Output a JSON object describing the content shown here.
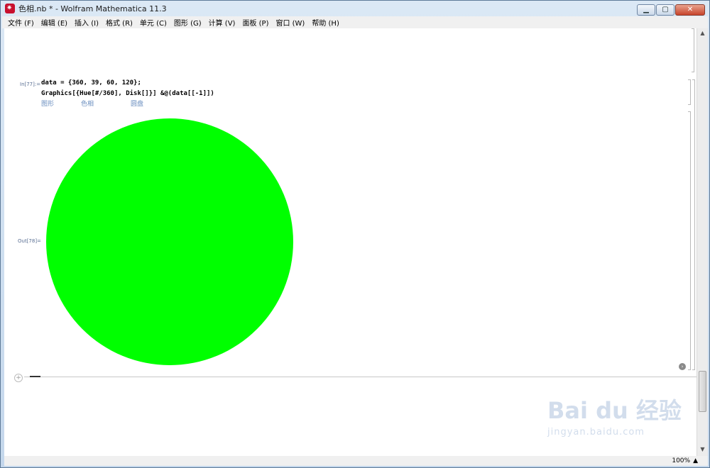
{
  "window": {
    "title": "色相.nb * - Wolfram Mathematica 11.3",
    "controls": {
      "minimize": "▁",
      "maximize": "▢",
      "close": "✕"
    }
  },
  "menu": [
    "文件 (F)",
    "编辑 (E)",
    "插入 (I)",
    "格式 (R)",
    "单元 (C)",
    "图形 (G)",
    "计算 (V)",
    "面板 (P)",
    "窗口 (W)",
    "帮助 (H)"
  ],
  "notebook": {
    "input_label": "In[77]:=",
    "code_line1": "data = {360, 39, 60, 120};",
    "code_line2": "Graphics[{Hue[#/360], Disk[]}] &@(data[[-1]])",
    "hints": [
      "图形",
      "色相",
      "圆盘"
    ],
    "output_label": "Out[78]=",
    "output": {
      "shape": "disk",
      "color": "#00ff00"
    }
  },
  "statusbar": {
    "zoom": "100%",
    "zoom_arrow": "▲"
  },
  "watermark": {
    "logo": "Bai du 经验",
    "url": "jingyan.baidu.com"
  }
}
